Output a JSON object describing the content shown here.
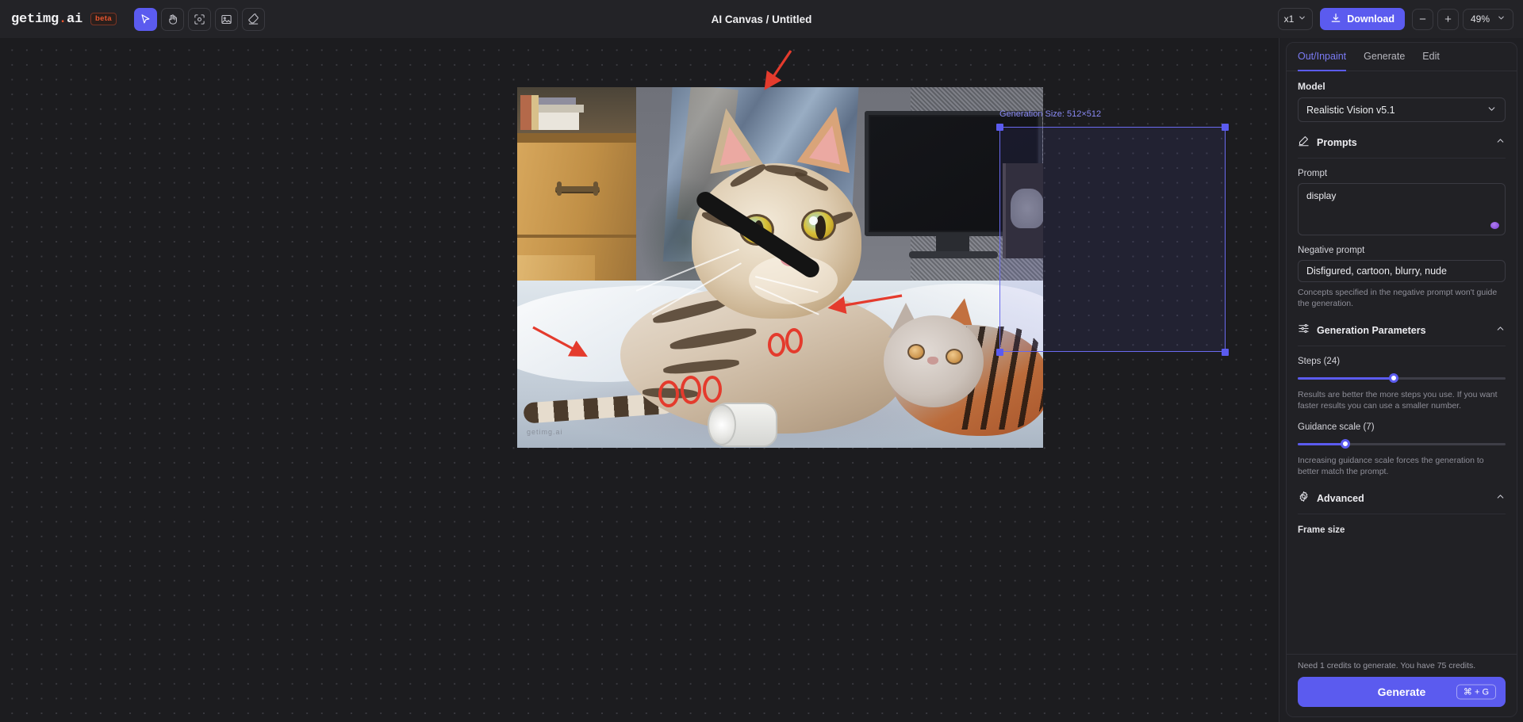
{
  "brand": {
    "name_prefix": "getimg",
    "name_dot": ".",
    "name_suffix": "ai",
    "badge": "beta"
  },
  "topbar": {
    "title": "AI Canvas / Untitled",
    "tools": [
      {
        "name": "select-tool",
        "icon": "cursor-icon",
        "active": true
      },
      {
        "name": "pan-tool",
        "icon": "hand-icon",
        "active": false
      },
      {
        "name": "frame-tool",
        "icon": "frame-select-icon",
        "active": false
      },
      {
        "name": "image-tool",
        "icon": "image-icon",
        "active": false
      },
      {
        "name": "eraser-tool",
        "icon": "eraser-icon",
        "active": false
      }
    ],
    "scale_value": "x1",
    "download_label": "Download",
    "zoom_out_label": "−",
    "zoom_in_label": "+",
    "zoom_level": "49%"
  },
  "canvas": {
    "selection_label": "Generation Size: 512×512",
    "watermark": "getimg.ai"
  },
  "panel": {
    "tabs": [
      {
        "label": "Out/Inpaint",
        "active": true
      },
      {
        "label": "Generate",
        "active": false
      },
      {
        "label": "Edit",
        "active": false
      }
    ],
    "model": {
      "label": "Model",
      "value": "Realistic Vision v5.1"
    },
    "prompts": {
      "section_title": "Prompts",
      "prompt_label": "Prompt",
      "prompt_value": "display",
      "negative_label": "Negative prompt",
      "negative_value": "Disfigured, cartoon, blurry, nude",
      "negative_hint": "Concepts specified in the negative prompt won't guide the generation."
    },
    "generation_parameters": {
      "section_title": "Generation Parameters",
      "steps_label": "Steps (24)",
      "steps_value": 24,
      "steps_percent": 46,
      "steps_hint": "Results are better the more steps you use. If you want faster results you can use a smaller number.",
      "guidance_label": "Guidance scale (7)",
      "guidance_value": 7,
      "guidance_percent": 23,
      "guidance_hint": "Increasing guidance scale forces the generation to better match the prompt."
    },
    "advanced": {
      "section_title": "Advanced",
      "frame_size_label": "Frame size"
    },
    "footer": {
      "credits_text": "Need 1 credits to generate. You have 75 credits.",
      "generate_label": "Generate",
      "shortcut": "⌘ + G"
    }
  },
  "colors": {
    "accent": "#5b5bef",
    "accent_text": "#7b7bf5",
    "brand_dot": "#e8552f",
    "panel_bg": "#212125",
    "canvas_bg": "#1c1c1f",
    "annotation_red": "#e43b2d"
  }
}
